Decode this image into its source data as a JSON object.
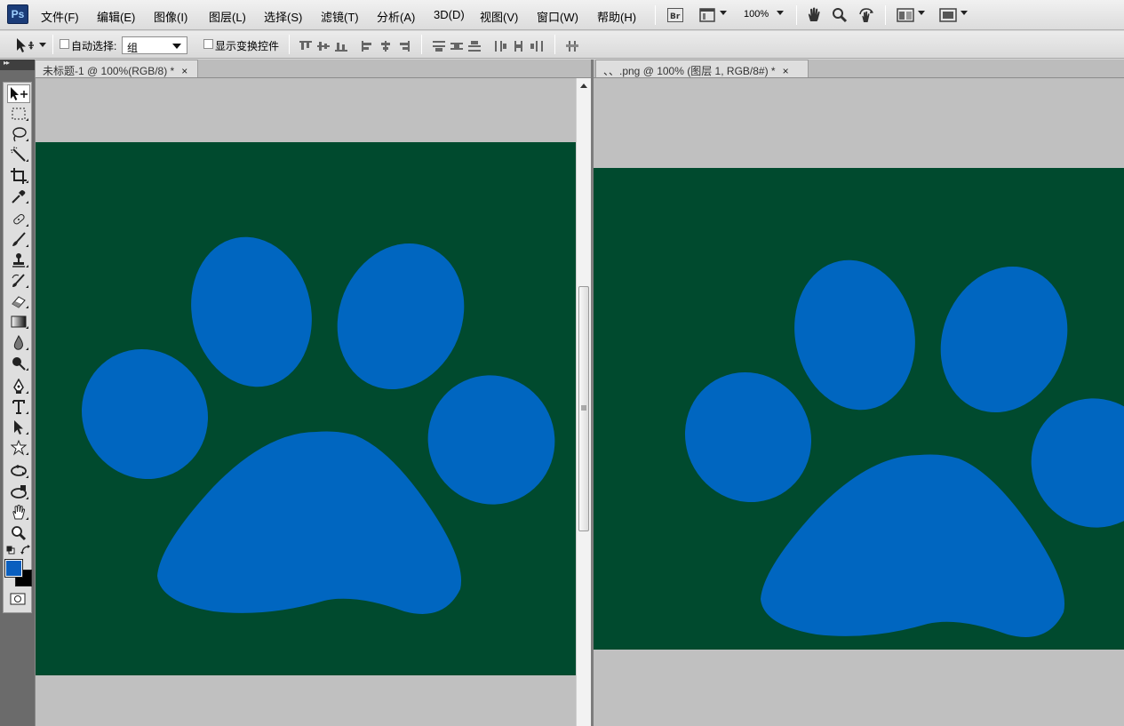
{
  "menubar": {
    "logo": "Ps",
    "items": [
      "文件(F)",
      "编辑(E)",
      "图像(I)",
      "图层(L)",
      "选择(S)",
      "滤镜(T)",
      "分析(A)",
      "3D(D)",
      "视图(V)",
      "窗口(W)",
      "帮助(H)"
    ],
    "bridge_label": "Br",
    "zoom": "100%",
    "icons": [
      "bridge-icon",
      "screen-layout-icon",
      "hand-icon",
      "zoom-icon",
      "rotate-view-icon",
      "arrange-documents-icon",
      "screen-mode-icon"
    ]
  },
  "options": {
    "auto_select_label": "自动选择:",
    "auto_select_value": "组",
    "show_transform_label": "显示变换控件"
  },
  "documents": [
    {
      "tab": "未标题-1 @ 100%(RGB/8) *",
      "close": "×"
    },
    {
      "tab": "、、.png @ 100% (图层 1, RGB/8#) *",
      "close": "×"
    }
  ],
  "colors": {
    "canvas_bg": "#004a2e",
    "paw": "#0066c0",
    "foreground": "#0a5fbf",
    "background": "#000000",
    "workspace": "#c0c0c0"
  },
  "tools": [
    "move-tool-icon",
    "marquee-tool-icon",
    "lasso-tool-icon",
    "magic-wand-tool-icon",
    "crop-tool-icon",
    "eyedropper-tool-icon",
    "healing-brush-tool-icon",
    "brush-tool-icon",
    "clone-stamp-tool-icon",
    "history-brush-tool-icon",
    "eraser-tool-icon",
    "gradient-tool-icon",
    "blur-tool-icon",
    "dodge-tool-icon",
    "pen-tool-icon",
    "type-tool-icon",
    "path-selection-tool-icon",
    "custom-shape-tool-icon",
    "3d-rotate-tool-icon",
    "3d-orbit-tool-icon",
    "hand-tool-icon",
    "zoom-tool-icon"
  ]
}
